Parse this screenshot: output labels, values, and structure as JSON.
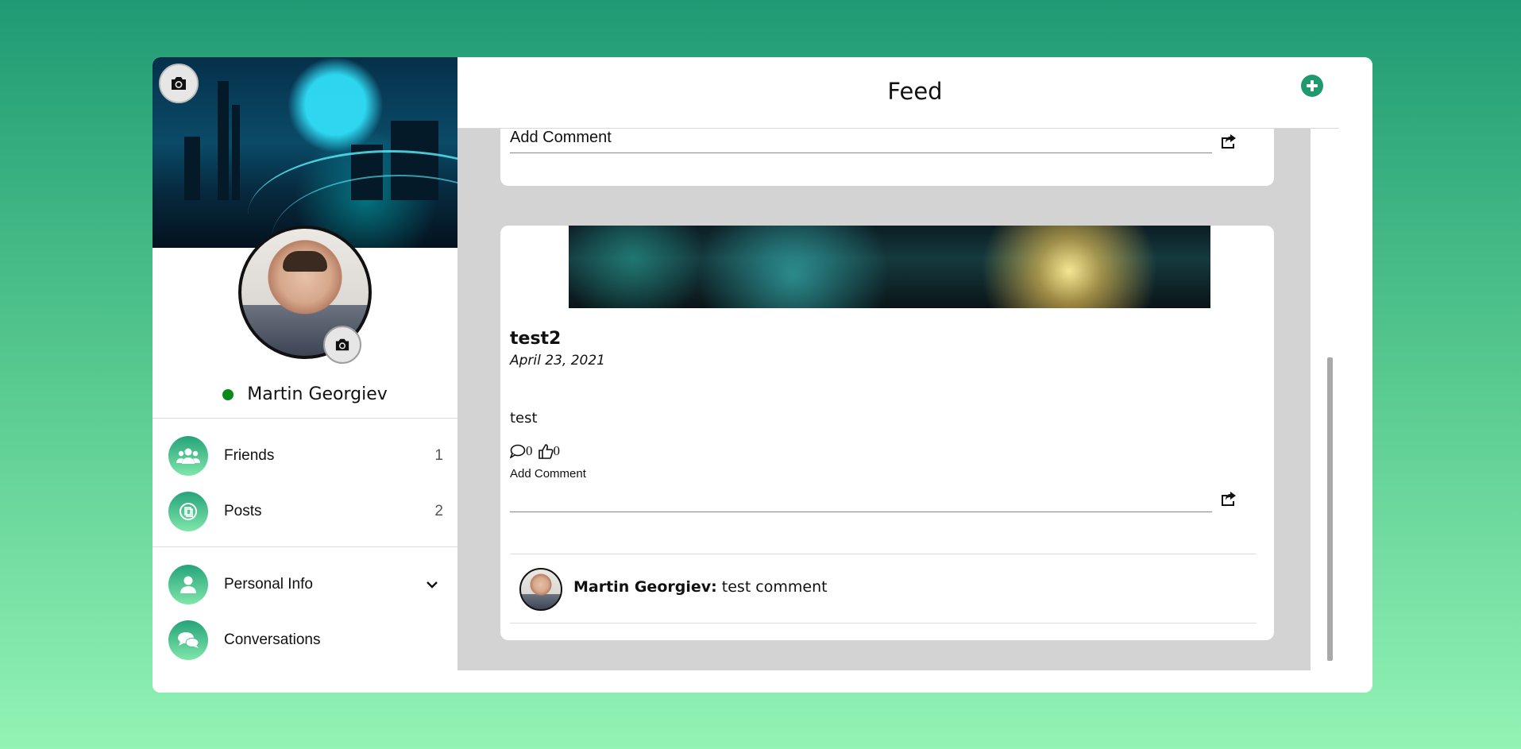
{
  "user": {
    "name": "Martin Georgiev",
    "status": "online",
    "status_color": "#0a8a1a"
  },
  "nav": {
    "items": [
      {
        "label": "Friends",
        "count": "1",
        "icon": "friends-icon"
      },
      {
        "label": "Posts",
        "count": "2",
        "icon": "posts-icon"
      },
      {
        "label": "Personal Info",
        "icon": "user-icon",
        "expandable": true
      },
      {
        "label": "Conversations",
        "icon": "conversations-icon"
      }
    ]
  },
  "header": {
    "title": "Feed",
    "add_icon": "plus-circle-icon"
  },
  "feed": {
    "prev_post": {
      "comment_placeholder": "Add Comment"
    },
    "post": {
      "title": "test2",
      "date": "April 23, 2021",
      "body": "test",
      "comments_count": "0",
      "likes_count": "0",
      "comment_label": "Add Comment",
      "comment_value": "",
      "comments": [
        {
          "author": "Martin Georgiev:",
          "text": "test comment"
        }
      ]
    }
  },
  "colors": {
    "accent": "#1f9a6e",
    "feed_bg": "#d3d3d3"
  }
}
